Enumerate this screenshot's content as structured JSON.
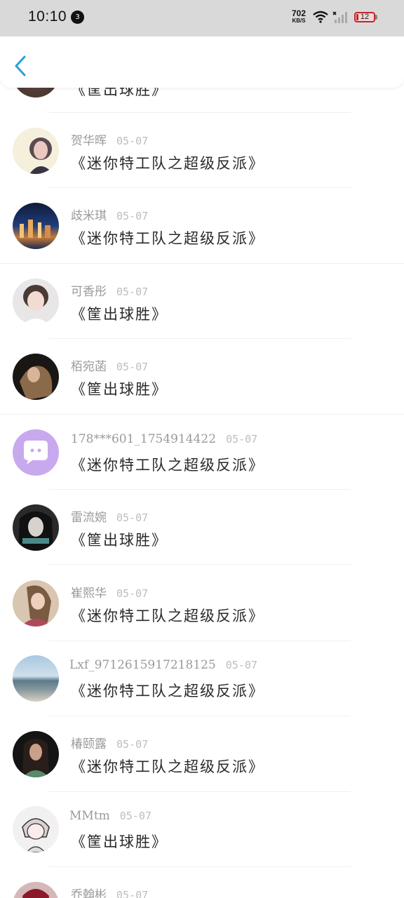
{
  "status_bar": {
    "time": "10:10",
    "notification_count": "3",
    "net_speed_value": "702",
    "net_speed_unit": "KB/S",
    "battery": "12"
  },
  "header": {
    "back_icon": "chevron-left-icon"
  },
  "comments": [
    {
      "name": "",
      "date": "",
      "title": "《筐出球胜》"
    },
    {
      "name": "贺华晖",
      "date": "05-07",
      "title": "《迷你特工队之超级反派》"
    },
    {
      "name": "歧米琪",
      "date": "05-07",
      "title": "《迷你特工队之超级反派》"
    },
    {
      "name": "可香彤",
      "date": "05-07",
      "title": "《筐出球胜》"
    },
    {
      "name": "栢宛菡",
      "date": "05-07",
      "title": "《筐出球胜》"
    },
    {
      "name": "178***601_1754914422",
      "date": "05-07",
      "title": "《迷你特工队之超级反派》"
    },
    {
      "name": "雷流婉",
      "date": "05-07",
      "title": "《筐出球胜》"
    },
    {
      "name": "崔熙华",
      "date": "05-07",
      "title": "《迷你特工队之超级反派》"
    },
    {
      "name": "Lxf_9712615917218125",
      "date": "05-07",
      "title": "《迷你特工队之超级反派》"
    },
    {
      "name": "椿颐露",
      "date": "05-07",
      "title": "《迷你特工队之超级反派》"
    },
    {
      "name": "MMtm",
      "date": "05-07",
      "title": "《筐出球胜》"
    },
    {
      "name": "乔翰彬",
      "date": "05-07",
      "title": ""
    }
  ],
  "colors": {
    "accent": "#2a9fd6",
    "battery_low": "#c0262b"
  }
}
